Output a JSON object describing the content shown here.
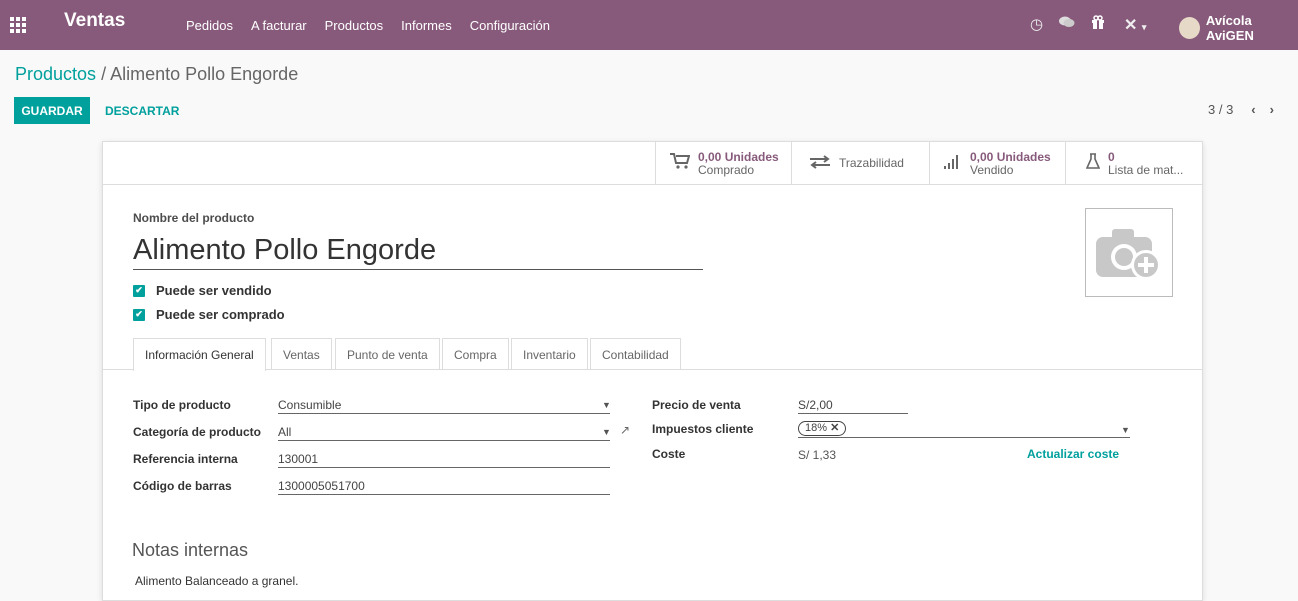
{
  "topbar": {
    "app_name": "Ventas",
    "menu": [
      "Pedidos",
      "A facturar",
      "Productos",
      "Informes",
      "Configuración"
    ],
    "user": "Avícola AviGEN",
    "icons": [
      "clock-icon",
      "chat-icon",
      "gift-icon",
      "tools-icon",
      "user-avatar"
    ]
  },
  "breadcrumb": {
    "parent": "Productos",
    "separator": "/",
    "current": "Alimento Pollo Engorde"
  },
  "actions": {
    "save": "GUARDAR",
    "discard": "DESCARTAR"
  },
  "pager": {
    "value": "3 / 3"
  },
  "stats": [
    {
      "value": "0,00 Unidades",
      "label": "Comprado",
      "icon": "cart-icon"
    },
    {
      "value": "",
      "label": "Trazabilidad",
      "icon": "exchange-icon"
    },
    {
      "value": "0,00 Unidades",
      "label": "Vendido",
      "icon": "signal-icon"
    },
    {
      "value": "0",
      "label": "Lista de mat...",
      "icon": "flask-icon"
    }
  ],
  "form": {
    "name_label": "Nombre del producto",
    "name": "Alimento Pollo Engorde",
    "can_be_sold": "Puede ser vendido",
    "can_be_purchased": "Puede ser comprado"
  },
  "tabs": [
    "Información General",
    "Ventas",
    "Punto de venta",
    "Compra",
    "Inventario",
    "Contabilidad"
  ],
  "general": {
    "type_label": "Tipo de producto",
    "type": "Consumible",
    "category_label": "Categoría de producto",
    "category": "All",
    "ref_label": "Referencia interna",
    "ref": "130001",
    "barcode_label": "Código de barras",
    "barcode": "1300005051700",
    "price_label": "Precio de venta",
    "price": "S/2,00",
    "taxes_label": "Impuestos cliente",
    "tax_tag": "18%",
    "cost_label": "Coste",
    "cost": "S/ 1,33",
    "update_cost": "Actualizar coste"
  },
  "notes": {
    "title": "Notas internas",
    "text": "Alimento Balanceado a granel."
  },
  "colors": {
    "brand": "#875a7b",
    "accent": "#00a09d"
  }
}
